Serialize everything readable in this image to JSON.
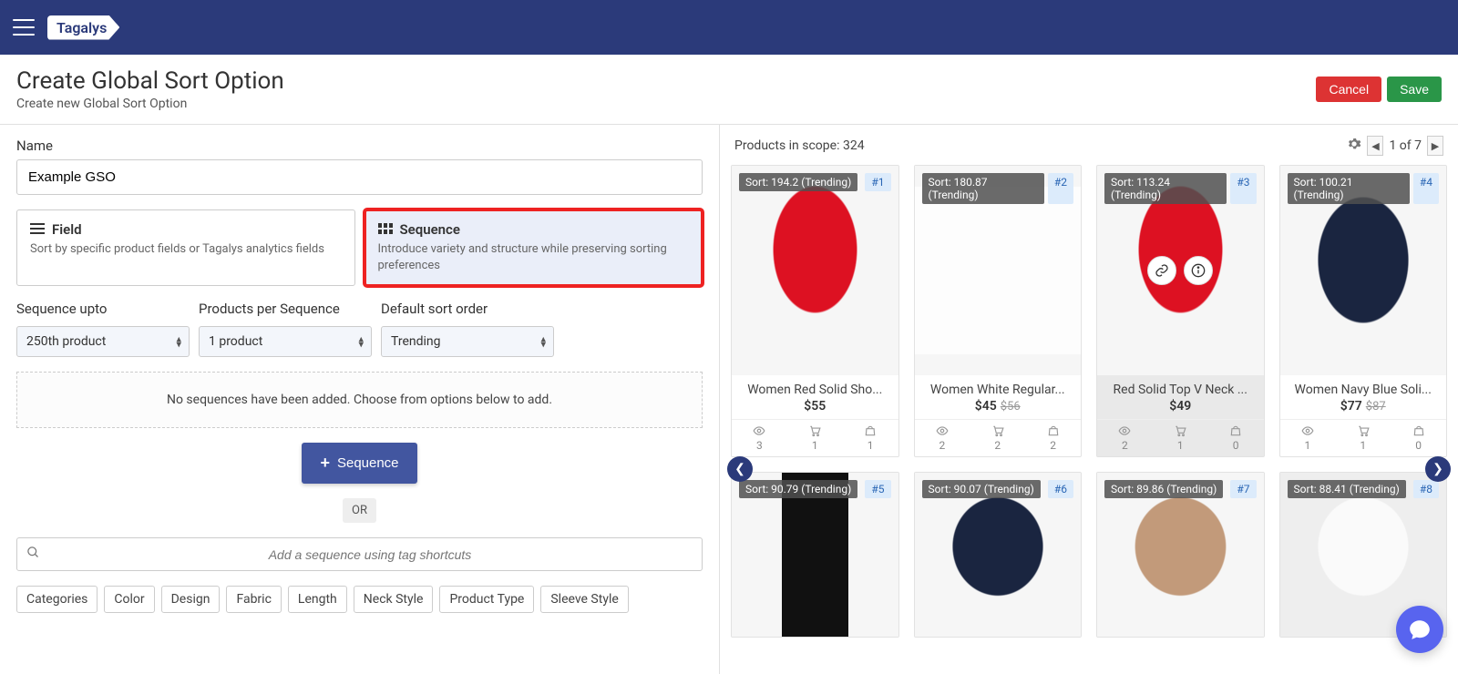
{
  "header": {
    "logo_text": "Tagalys",
    "title": "Create Global Sort Option",
    "subtitle": "Create new Global Sort Option",
    "cancel_label": "Cancel",
    "save_label": "Save"
  },
  "form": {
    "name_label": "Name",
    "name_value": "Example GSO",
    "field_option": {
      "title": "Field",
      "desc": "Sort by specific product fields or Tagalys analytics fields"
    },
    "sequence_option": {
      "title": "Sequence",
      "desc": "Introduce variety and structure while preserving sorting preferences"
    },
    "sequence_upto_label": "Sequence upto",
    "sequence_upto_value": "250th product",
    "products_per_seq_label": "Products per Sequence",
    "products_per_seq_value": "1 product",
    "default_sort_label": "Default sort order",
    "default_sort_value": "Trending",
    "empty_msg": "No sequences have been added. Choose from options below to add.",
    "add_sequence_label": "Sequence",
    "or_label": "OR",
    "tag_search_placeholder": "Add a sequence using tag shortcuts",
    "tags": [
      "Categories",
      "Color",
      "Design",
      "Fabric",
      "Length",
      "Neck Style",
      "Product Type",
      "Sleeve Style"
    ]
  },
  "preview": {
    "scope_prefix": "Products in scope: ",
    "scope_count": "324",
    "pager_text": "1 of 7",
    "products_row1": [
      {
        "sort": "Sort: 194.2 (Trending)",
        "rank": "#1",
        "title": "Women Red Solid Sho...",
        "price": "$55",
        "strike": "",
        "views": "3",
        "carts": "1",
        "buys": "1",
        "cls": "red-top",
        "hover": false
      },
      {
        "sort": "Sort: 180.87 (Trending)",
        "rank": "#2",
        "title": "Women White Regular...",
        "price": "$45",
        "strike": "$56",
        "views": "2",
        "carts": "2",
        "buys": "2",
        "cls": "white-pants",
        "hover": false
      },
      {
        "sort": "Sort: 113.24 (Trending)",
        "rank": "#3",
        "title": "Red Solid Top V Neck ...",
        "price": "$49",
        "strike": "",
        "views": "2",
        "carts": "1",
        "buys": "0",
        "cls": "red-top",
        "hover": true
      },
      {
        "sort": "Sort: 100.21 (Trending)",
        "rank": "#4",
        "title": "Women Navy Blue Soli...",
        "price": "$77",
        "strike": "$87",
        "views": "1",
        "carts": "1",
        "buys": "0",
        "cls": "navy-top",
        "hover": false
      }
    ],
    "products_row2": [
      {
        "sort": "Sort: 90.79 (Trending)",
        "rank": "#5",
        "cls": "black-pants"
      },
      {
        "sort": "Sort: 90.07 (Trending)",
        "rank": "#6",
        "cls": "navy-top"
      },
      {
        "sort": "Sort: 89.86 (Trending)",
        "rank": "#7",
        "cls": "tan-top"
      },
      {
        "sort": "Sort: 88.41 (Trending)",
        "rank": "#8",
        "cls": "white-top"
      }
    ]
  }
}
